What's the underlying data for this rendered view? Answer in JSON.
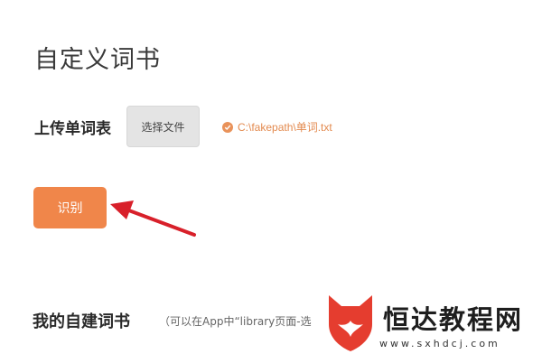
{
  "page": {
    "title": "自定义词书"
  },
  "upload": {
    "label": "上传单词表",
    "choose_file_label": "选择文件",
    "file_path": "C:\\fakepath\\单词.txt"
  },
  "recognize_label": "识别",
  "section": {
    "title": "我的自建词书",
    "hint": "（可以在App中“library页面-选"
  },
  "watermark": {
    "text": "恒达教程网",
    "url": "www.sxhdcj.com"
  },
  "colors": {
    "accent": "#f0864a",
    "arrow": "#d8202a",
    "logo": "#e53d2f"
  },
  "icons": {
    "file_status": "check-circle-icon",
    "annotation": "red-arrow",
    "logo": "fox-heart-logo"
  }
}
